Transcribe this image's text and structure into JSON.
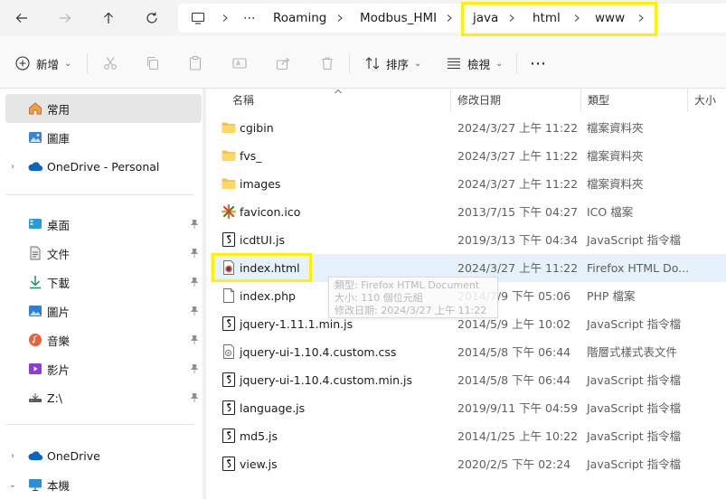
{
  "address_bar": {
    "crumbs": [
      "Roaming",
      "Modbus_HMI",
      "java",
      "html",
      "www"
    ],
    "overflow_glyph": "⋯"
  },
  "toolbar": {
    "new_label": "新增",
    "sort_label": "排序",
    "view_label": "檢視",
    "more_glyph": "⋯"
  },
  "nav": {
    "items": [
      {
        "label": "常用",
        "icon": "home-icon"
      },
      {
        "label": "圖庫",
        "icon": "gallery-icon"
      },
      {
        "label": "OneDrive - Personal",
        "icon": "cloud-icon"
      },
      {
        "label": "桌面",
        "icon": "desktop-icon"
      },
      {
        "label": "文件",
        "icon": "document-icon"
      },
      {
        "label": "下載",
        "icon": "download-icon"
      },
      {
        "label": "圖片",
        "icon": "pictures-icon"
      },
      {
        "label": "音樂",
        "icon": "music-icon"
      },
      {
        "label": "影片",
        "icon": "video-icon"
      },
      {
        "label": "Z:\\",
        "icon": "network-drive-icon"
      },
      {
        "label": "OneDrive",
        "icon": "cloud-icon"
      },
      {
        "label": "本機",
        "icon": "this-pc-icon"
      }
    ]
  },
  "columns": {
    "name": "名稱",
    "date": "修改日期",
    "type": "類型",
    "size": "大小"
  },
  "files": [
    {
      "name": "cgibin",
      "date": "2024/3/27 上午 11:22",
      "type": "檔案資料夾",
      "icon": "folder-icon"
    },
    {
      "name": "fvs_",
      "date": "2024/3/27 上午 11:22",
      "type": "檔案資料夾",
      "icon": "folder-icon"
    },
    {
      "name": "images",
      "date": "2024/3/27 上午 11:22",
      "type": "檔案資料夾",
      "icon": "folder-icon"
    },
    {
      "name": "favicon.ico",
      "date": "2013/7/15 下午 04:27",
      "type": "ICO 檔案",
      "icon": "ico-file-icon"
    },
    {
      "name": "icdtUI.js",
      "date": "2019/3/13 下午 04:34",
      "type": "JavaScript 指令檔",
      "icon": "js-file-icon"
    },
    {
      "name": "index.html",
      "date": "2024/3/27 上午 11:22",
      "type": "Firefox HTML Do...",
      "icon": "html-file-icon"
    },
    {
      "name": "index.php",
      "date": "2014/7/9 下午 05:06",
      "type": "PHP 檔案",
      "icon": "blank-file-icon"
    },
    {
      "name": "jquery-1.11.1.min.js",
      "date": "2014/5/9 上午 10:02",
      "type": "JavaScript 指令檔",
      "icon": "js-file-icon"
    },
    {
      "name": "jquery-ui-1.10.4.custom.css",
      "date": "2014/5/8 下午 06:44",
      "type": "階層式樣式表文件",
      "icon": "css-file-icon"
    },
    {
      "name": "jquery-ui-1.10.4.custom.min.js",
      "date": "2014/5/8 下午 06:44",
      "type": "JavaScript 指令檔",
      "icon": "js-file-icon"
    },
    {
      "name": "language.js",
      "date": "2019/9/11 下午 04:59",
      "type": "JavaScript 指令檔",
      "icon": "js-file-icon"
    },
    {
      "name": "md5.js",
      "date": "2014/1/25 上午 10:22",
      "type": "JavaScript 指令檔",
      "icon": "js-file-icon"
    },
    {
      "name": "view.js",
      "date": "2020/2/5 下午 02:24",
      "type": "JavaScript 指令檔",
      "icon": "js-file-icon"
    }
  ],
  "tooltip": {
    "line1": "類型: Firefox HTML Document",
    "line2": "大小: 110 個位元組",
    "line3": "修改日期: 2024/3/27 上午 11:22"
  },
  "colors": {
    "highlight_box": "#fff200",
    "hover_row": "#e5f1fb",
    "folder": "#f4c34f",
    "accent": "#0067c0"
  }
}
